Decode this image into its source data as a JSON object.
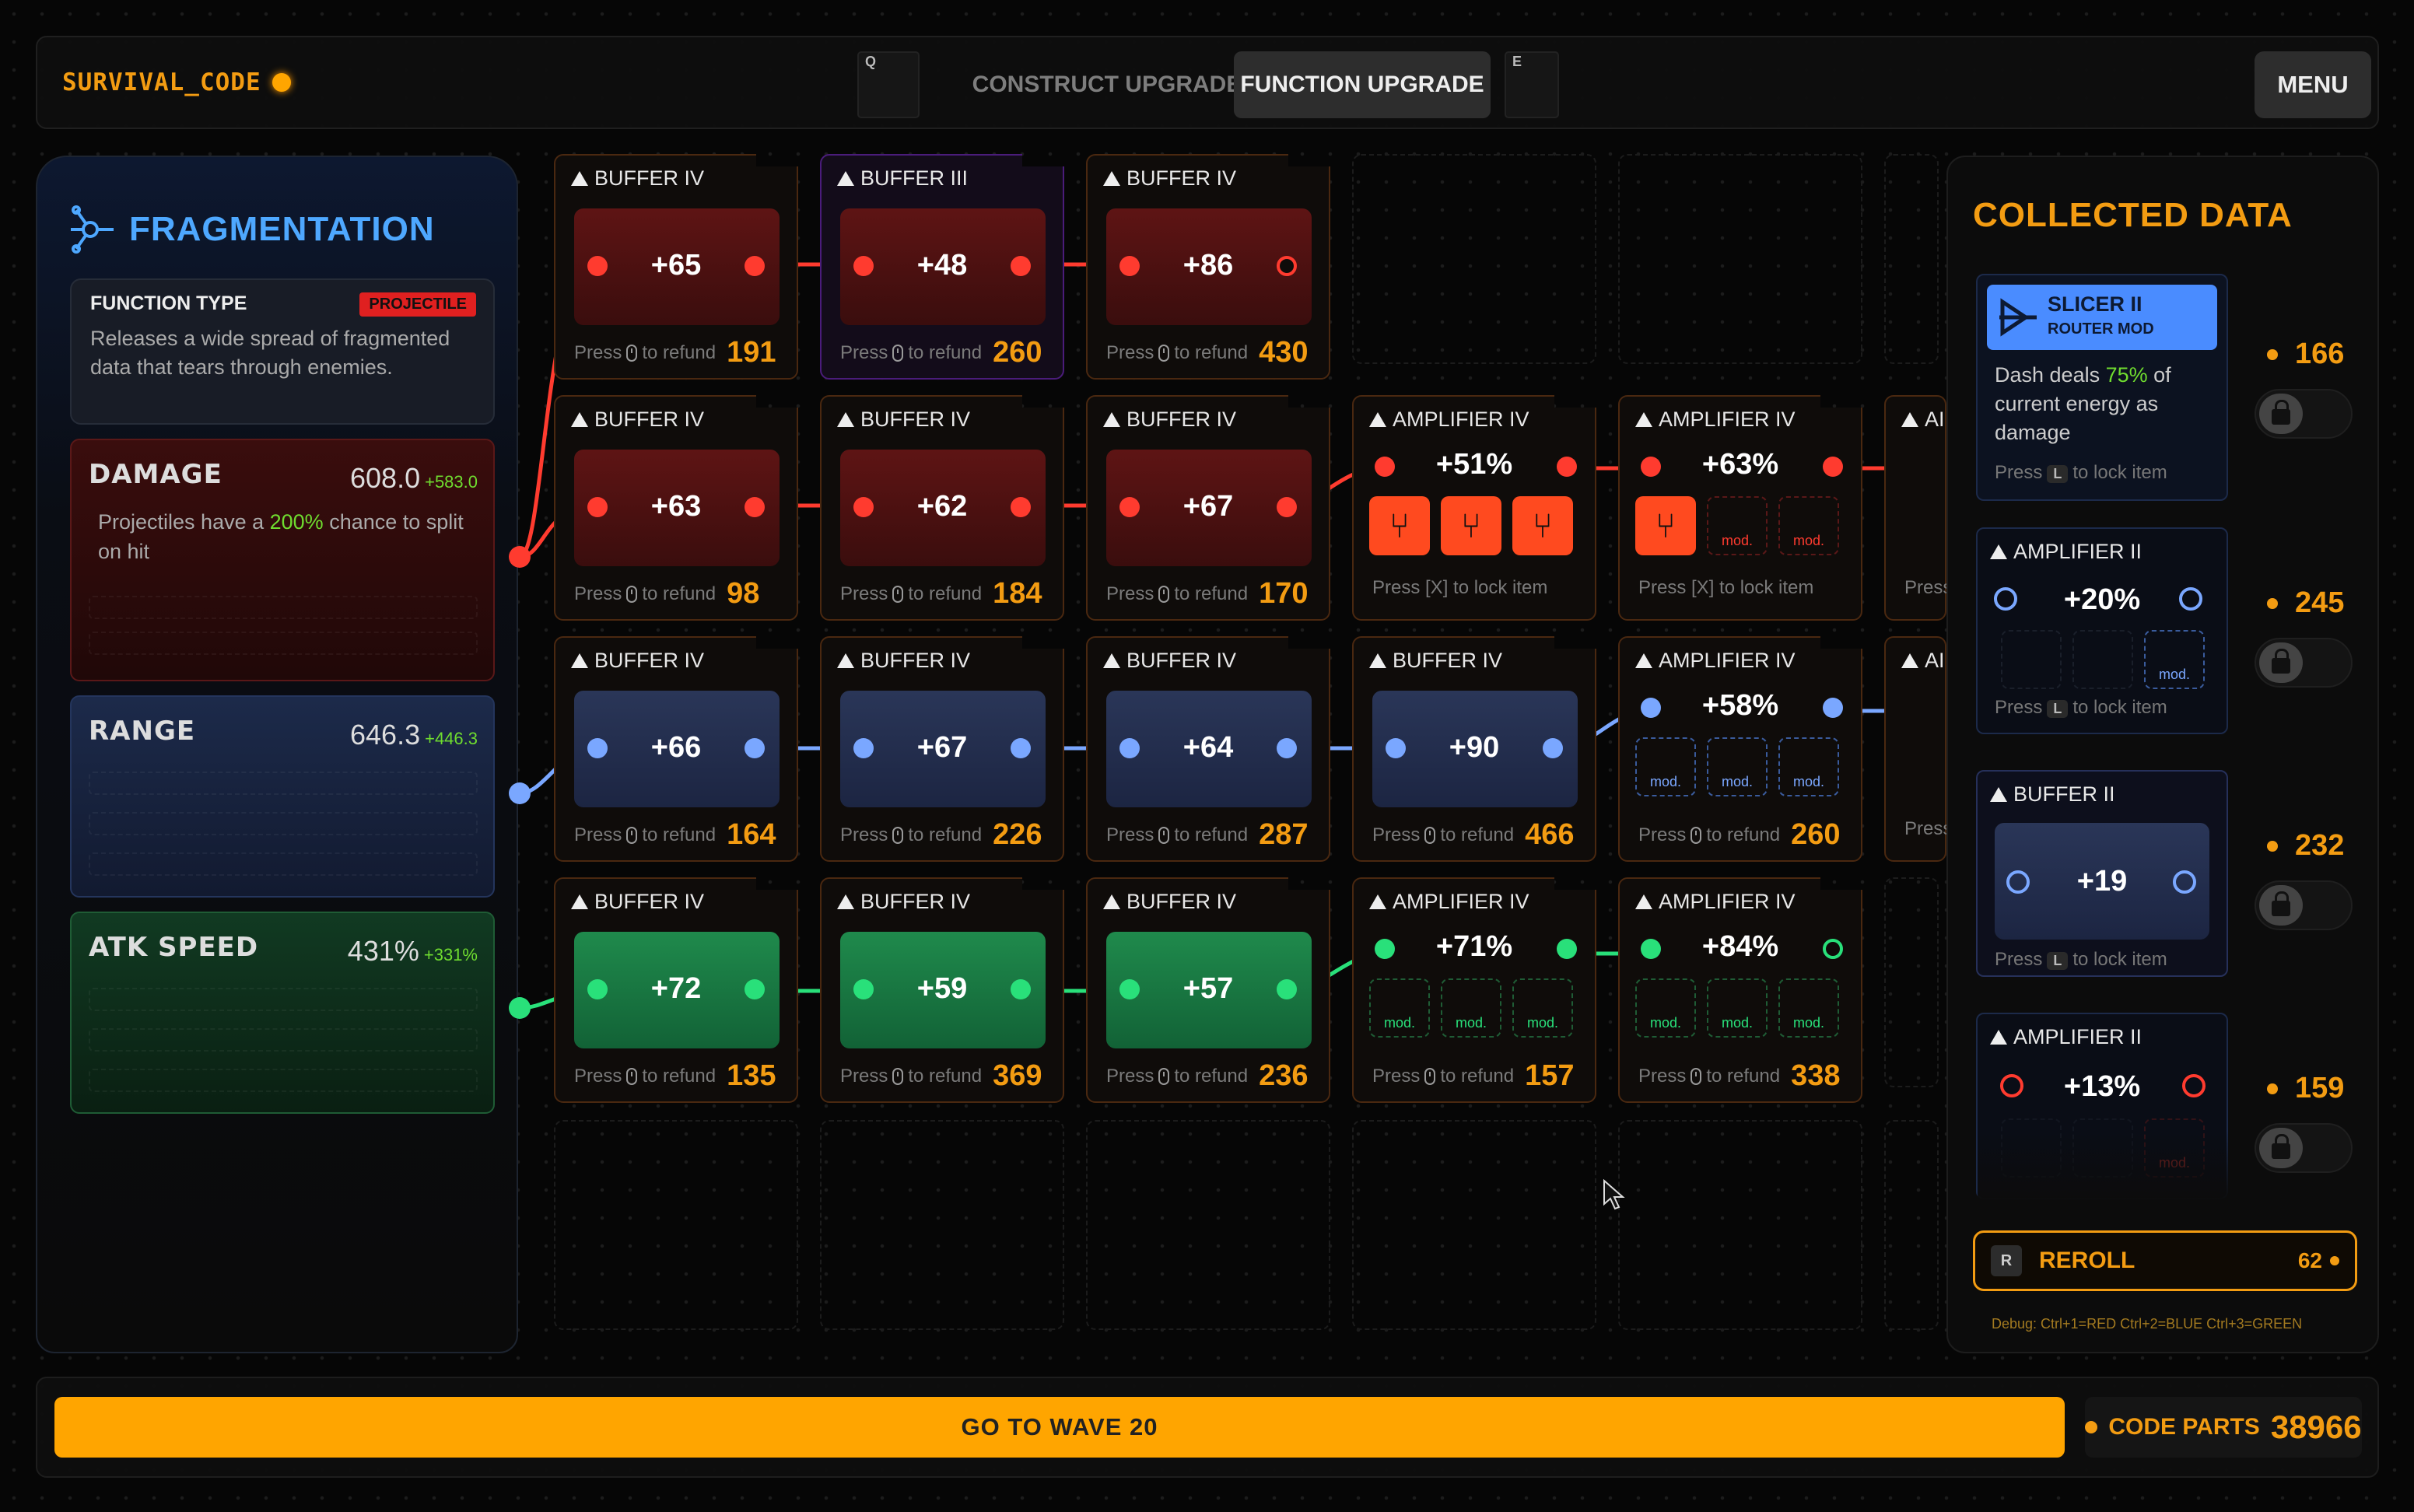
{
  "topbar": {
    "brand": "SURVIVAL_CODE",
    "tabs": [
      {
        "label": "Q"
      },
      {
        "label": "CONSTRUCT UPGRADE"
      },
      {
        "label": "FUNCTION UPGRADE",
        "active": true
      },
      {
        "label": "E"
      }
    ],
    "menu": "MENU"
  },
  "function": {
    "title": "FRAGMENTATION",
    "type_label": "FUNCTION TYPE",
    "type_badge": "PROJECTILE",
    "description": "Releases a wide spread of fragmented data that tears through enemies."
  },
  "stats": [
    {
      "name": "DAMAGE",
      "value": "608.0",
      "bonus": "+583.0",
      "text_pre": "Projectiles have a ",
      "text_hl": "200%",
      "text_post": " chance to split on hit"
    },
    {
      "name": "RANGE",
      "value": "646.3",
      "bonus": "+446.3"
    },
    {
      "name": "ATK SPEED",
      "value": "431%",
      "bonus": "+331%"
    }
  ],
  "cards": {
    "refund_prefix": "Press",
    "refund_suffix": "to refund",
    "lock_hint": "Press [X] to lock item",
    "mod_label": "mod.",
    "r0": [
      {
        "title": "BUFFER IV",
        "value": "+65",
        "cost": "191"
      },
      {
        "title": "BUFFER III",
        "value": "+48",
        "cost": "260"
      },
      {
        "title": "BUFFER IV",
        "value": "+86",
        "cost": "430"
      }
    ],
    "r1": [
      {
        "title": "BUFFER IV",
        "value": "+63",
        "cost": "98"
      },
      {
        "title": "BUFFER IV",
        "value": "+62",
        "cost": "184"
      },
      {
        "title": "BUFFER IV",
        "value": "+67",
        "cost": "170"
      },
      {
        "title": "AMPLIFIER IV",
        "value": "+51%"
      },
      {
        "title": "AMPLIFIER IV",
        "value": "+63%"
      },
      {
        "title": "AI"
      }
    ],
    "r2": [
      {
        "title": "BUFFER IV",
        "value": "+66",
        "cost": "164"
      },
      {
        "title": "BUFFER IV",
        "value": "+67",
        "cost": "226"
      },
      {
        "title": "BUFFER IV",
        "value": "+64",
        "cost": "287"
      },
      {
        "title": "BUFFER IV",
        "value": "+90",
        "cost": "466"
      },
      {
        "title": "AMPLIFIER IV",
        "value": "+58%",
        "cost": "260"
      },
      {
        "title": "AI"
      }
    ],
    "r3": [
      {
        "title": "BUFFER IV",
        "value": "+72",
        "cost": "135"
      },
      {
        "title": "BUFFER IV",
        "value": "+59",
        "cost": "369"
      },
      {
        "title": "BUFFER IV",
        "value": "+57",
        "cost": "236"
      },
      {
        "title": "AMPLIFIER IV",
        "value": "+71%",
        "cost": "157"
      },
      {
        "title": "AMPLIFIER IV",
        "value": "+84%",
        "cost": "338"
      }
    ],
    "partial_foot": "Press"
  },
  "collected": {
    "title": "COLLECTED DATA",
    "items": [
      {
        "title": "SLICER II",
        "subtitle": "ROUTER MOD",
        "desc_pre": "Dash deals ",
        "desc_hl": "75%",
        "desc_post": " of current energy as damage",
        "hint_pre": "Press",
        "key": "L",
        "hint_post": "to lock item",
        "cost": "166"
      },
      {
        "title": "AMPLIFIER II",
        "value": "+20%",
        "hint_pre": "Press",
        "key": "L",
        "hint_post": "to lock item",
        "cost": "245"
      },
      {
        "title": "BUFFER II",
        "value": "+19",
        "hint_pre": "Press",
        "key": "L",
        "hint_post": "to lock item",
        "cost": "232"
      },
      {
        "title": "AMPLIFIER II",
        "value": "+13%",
        "cost": "159"
      }
    ],
    "reroll": {
      "key": "R",
      "label": "REROLL",
      "cost": "62"
    },
    "debug": "Debug: Ctrl+1=RED  Ctrl+2=BLUE  Ctrl+3=GREEN"
  },
  "bottom": {
    "go_wave": "GO TO WAVE 20",
    "parts_label": "CODE PARTS",
    "parts_value": "38966"
  },
  "colors": {
    "red": "#ff3b2f",
    "blue": "#7aa7ff",
    "green": "#29e07a",
    "accent": "#f39c12"
  }
}
